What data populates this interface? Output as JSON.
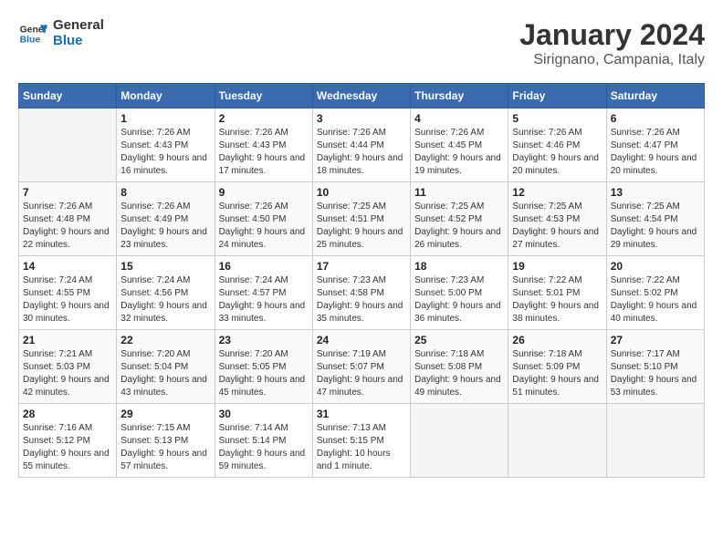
{
  "header": {
    "logo_line1": "General",
    "logo_line2": "Blue",
    "month": "January 2024",
    "location": "Sirignano, Campania, Italy"
  },
  "columns": [
    "Sunday",
    "Monday",
    "Tuesday",
    "Wednesday",
    "Thursday",
    "Friday",
    "Saturday"
  ],
  "weeks": [
    [
      {
        "day": "",
        "sunrise": "",
        "sunset": "",
        "daylight": ""
      },
      {
        "day": "1",
        "sunrise": "7:26 AM",
        "sunset": "4:43 PM",
        "daylight": "9 hours and 16 minutes."
      },
      {
        "day": "2",
        "sunrise": "7:26 AM",
        "sunset": "4:43 PM",
        "daylight": "9 hours and 17 minutes."
      },
      {
        "day": "3",
        "sunrise": "7:26 AM",
        "sunset": "4:44 PM",
        "daylight": "9 hours and 18 minutes."
      },
      {
        "day": "4",
        "sunrise": "7:26 AM",
        "sunset": "4:45 PM",
        "daylight": "9 hours and 19 minutes."
      },
      {
        "day": "5",
        "sunrise": "7:26 AM",
        "sunset": "4:46 PM",
        "daylight": "9 hours and 20 minutes."
      },
      {
        "day": "6",
        "sunrise": "7:26 AM",
        "sunset": "4:47 PM",
        "daylight": "9 hours and 20 minutes."
      }
    ],
    [
      {
        "day": "7",
        "sunrise": "7:26 AM",
        "sunset": "4:48 PM",
        "daylight": "9 hours and 22 minutes."
      },
      {
        "day": "8",
        "sunrise": "7:26 AM",
        "sunset": "4:49 PM",
        "daylight": "9 hours and 23 minutes."
      },
      {
        "day": "9",
        "sunrise": "7:26 AM",
        "sunset": "4:50 PM",
        "daylight": "9 hours and 24 minutes."
      },
      {
        "day": "10",
        "sunrise": "7:25 AM",
        "sunset": "4:51 PM",
        "daylight": "9 hours and 25 minutes."
      },
      {
        "day": "11",
        "sunrise": "7:25 AM",
        "sunset": "4:52 PM",
        "daylight": "9 hours and 26 minutes."
      },
      {
        "day": "12",
        "sunrise": "7:25 AM",
        "sunset": "4:53 PM",
        "daylight": "9 hours and 27 minutes."
      },
      {
        "day": "13",
        "sunrise": "7:25 AM",
        "sunset": "4:54 PM",
        "daylight": "9 hours and 29 minutes."
      }
    ],
    [
      {
        "day": "14",
        "sunrise": "7:24 AM",
        "sunset": "4:55 PM",
        "daylight": "9 hours and 30 minutes."
      },
      {
        "day": "15",
        "sunrise": "7:24 AM",
        "sunset": "4:56 PM",
        "daylight": "9 hours and 32 minutes."
      },
      {
        "day": "16",
        "sunrise": "7:24 AM",
        "sunset": "4:57 PM",
        "daylight": "9 hours and 33 minutes."
      },
      {
        "day": "17",
        "sunrise": "7:23 AM",
        "sunset": "4:58 PM",
        "daylight": "9 hours and 35 minutes."
      },
      {
        "day": "18",
        "sunrise": "7:23 AM",
        "sunset": "5:00 PM",
        "daylight": "9 hours and 36 minutes."
      },
      {
        "day": "19",
        "sunrise": "7:22 AM",
        "sunset": "5:01 PM",
        "daylight": "9 hours and 38 minutes."
      },
      {
        "day": "20",
        "sunrise": "7:22 AM",
        "sunset": "5:02 PM",
        "daylight": "9 hours and 40 minutes."
      }
    ],
    [
      {
        "day": "21",
        "sunrise": "7:21 AM",
        "sunset": "5:03 PM",
        "daylight": "9 hours and 42 minutes."
      },
      {
        "day": "22",
        "sunrise": "7:20 AM",
        "sunset": "5:04 PM",
        "daylight": "9 hours and 43 minutes."
      },
      {
        "day": "23",
        "sunrise": "7:20 AM",
        "sunset": "5:05 PM",
        "daylight": "9 hours and 45 minutes."
      },
      {
        "day": "24",
        "sunrise": "7:19 AM",
        "sunset": "5:07 PM",
        "daylight": "9 hours and 47 minutes."
      },
      {
        "day": "25",
        "sunrise": "7:18 AM",
        "sunset": "5:08 PM",
        "daylight": "9 hours and 49 minutes."
      },
      {
        "day": "26",
        "sunrise": "7:18 AM",
        "sunset": "5:09 PM",
        "daylight": "9 hours and 51 minutes."
      },
      {
        "day": "27",
        "sunrise": "7:17 AM",
        "sunset": "5:10 PM",
        "daylight": "9 hours and 53 minutes."
      }
    ],
    [
      {
        "day": "28",
        "sunrise": "7:16 AM",
        "sunset": "5:12 PM",
        "daylight": "9 hours and 55 minutes."
      },
      {
        "day": "29",
        "sunrise": "7:15 AM",
        "sunset": "5:13 PM",
        "daylight": "9 hours and 57 minutes."
      },
      {
        "day": "30",
        "sunrise": "7:14 AM",
        "sunset": "5:14 PM",
        "daylight": "9 hours and 59 minutes."
      },
      {
        "day": "31",
        "sunrise": "7:13 AM",
        "sunset": "5:15 PM",
        "daylight": "10 hours and 1 minute."
      },
      {
        "day": "",
        "sunrise": "",
        "sunset": "",
        "daylight": ""
      },
      {
        "day": "",
        "sunrise": "",
        "sunset": "",
        "daylight": ""
      },
      {
        "day": "",
        "sunrise": "",
        "sunset": "",
        "daylight": ""
      }
    ]
  ]
}
